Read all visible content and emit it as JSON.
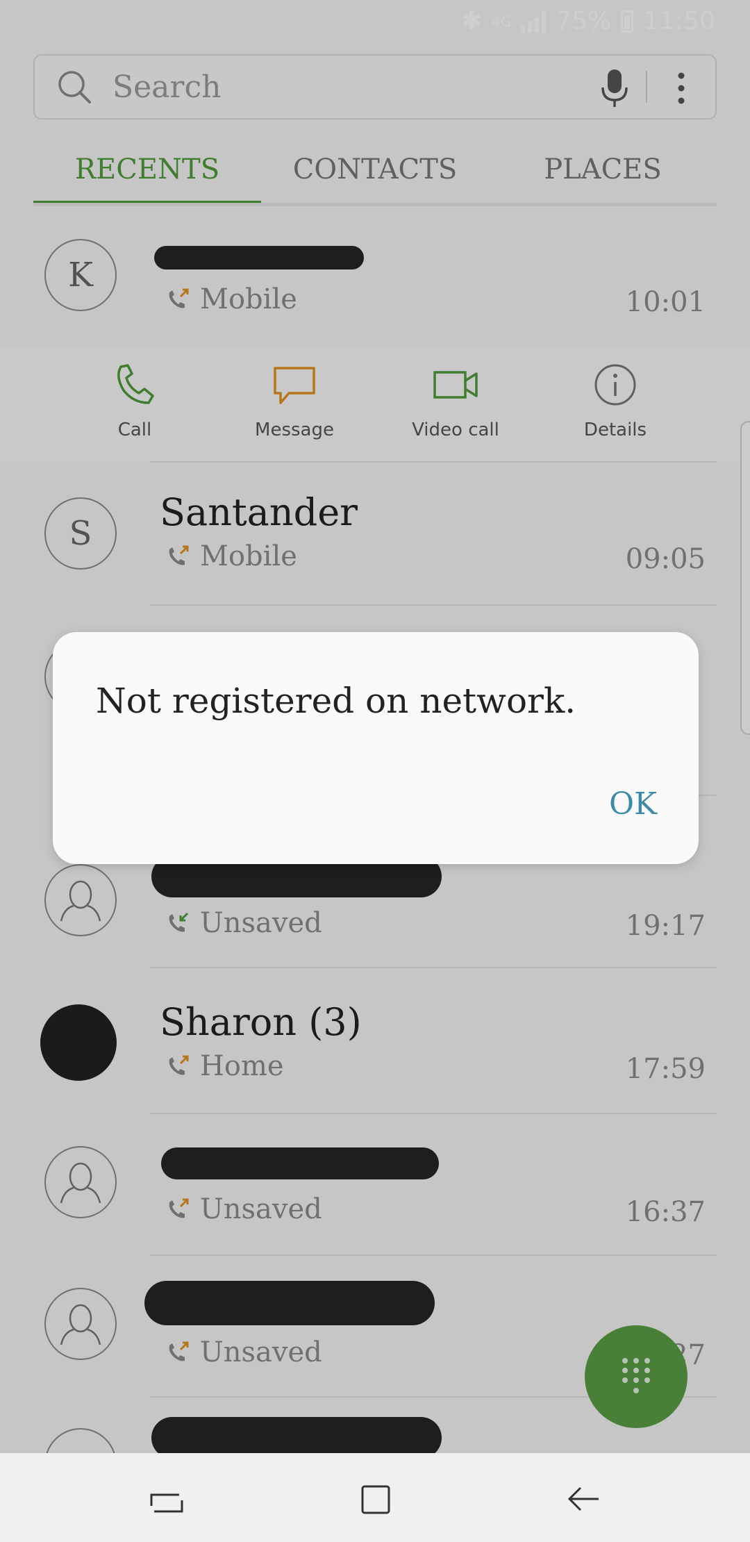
{
  "status_bar": {
    "network": "4G",
    "battery": "75%",
    "time": "11:50"
  },
  "search": {
    "placeholder": "Search"
  },
  "tabs": [
    {
      "label": "RECENTS",
      "active": true
    },
    {
      "label": "CONTACTS",
      "active": false
    },
    {
      "label": "PLACES",
      "active": false
    }
  ],
  "calls": [
    {
      "avatar": "K",
      "type": "Mobile",
      "time": "10:01",
      "direction": "outgoing"
    },
    {
      "avatar": "S",
      "name": "Santander",
      "type": "Mobile",
      "time": "09:05",
      "direction": "outgoing"
    },
    {
      "type": "Unsaved",
      "time": "19:17",
      "direction": "incoming"
    },
    {
      "name": "Sharon (3)",
      "type": "Home",
      "time": "17:59",
      "direction": "outgoing"
    },
    {
      "type": "Unsaved",
      "time": "16:37",
      "direction": "outgoing"
    },
    {
      "type": "Unsaved",
      "time": "27",
      "direction": "outgoing"
    }
  ],
  "quick_actions": [
    {
      "label": "Call",
      "icon": "phone-icon"
    },
    {
      "label": "Message",
      "icon": "message-icon"
    },
    {
      "label": "Video call",
      "icon": "video-call-icon"
    },
    {
      "label": "Details",
      "icon": "info-icon"
    }
  ],
  "dialog": {
    "message": "Not registered on network.",
    "ok_label": "OK"
  },
  "colors": {
    "accent": "#4f9a3b",
    "message_orange": "#e0911f",
    "ok": "#3d8aa6",
    "fab": "#5a9e45"
  }
}
